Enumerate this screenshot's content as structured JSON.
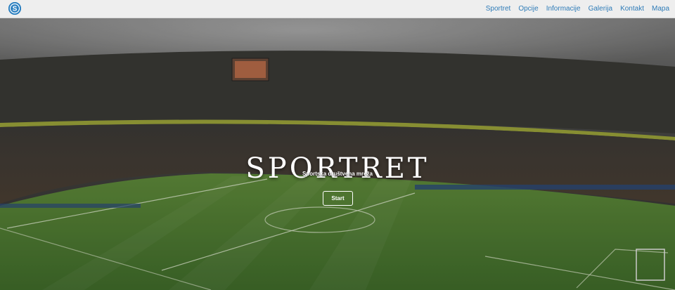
{
  "brand": {
    "logo_letter": "S",
    "logo_icon": "sportret-logo-icon",
    "accent": "#2a7fc0"
  },
  "nav": {
    "items": [
      {
        "label": "Sportret"
      },
      {
        "label": "Opcije"
      },
      {
        "label": "Informacije"
      },
      {
        "label": "Galerija"
      },
      {
        "label": "Kontakt"
      },
      {
        "label": "Mapa"
      }
    ],
    "link_color": "#2f7cb8"
  },
  "hero": {
    "title": "SPORTRET",
    "subtitle": "Sportska društvena mreža",
    "cta_label": "Start"
  }
}
